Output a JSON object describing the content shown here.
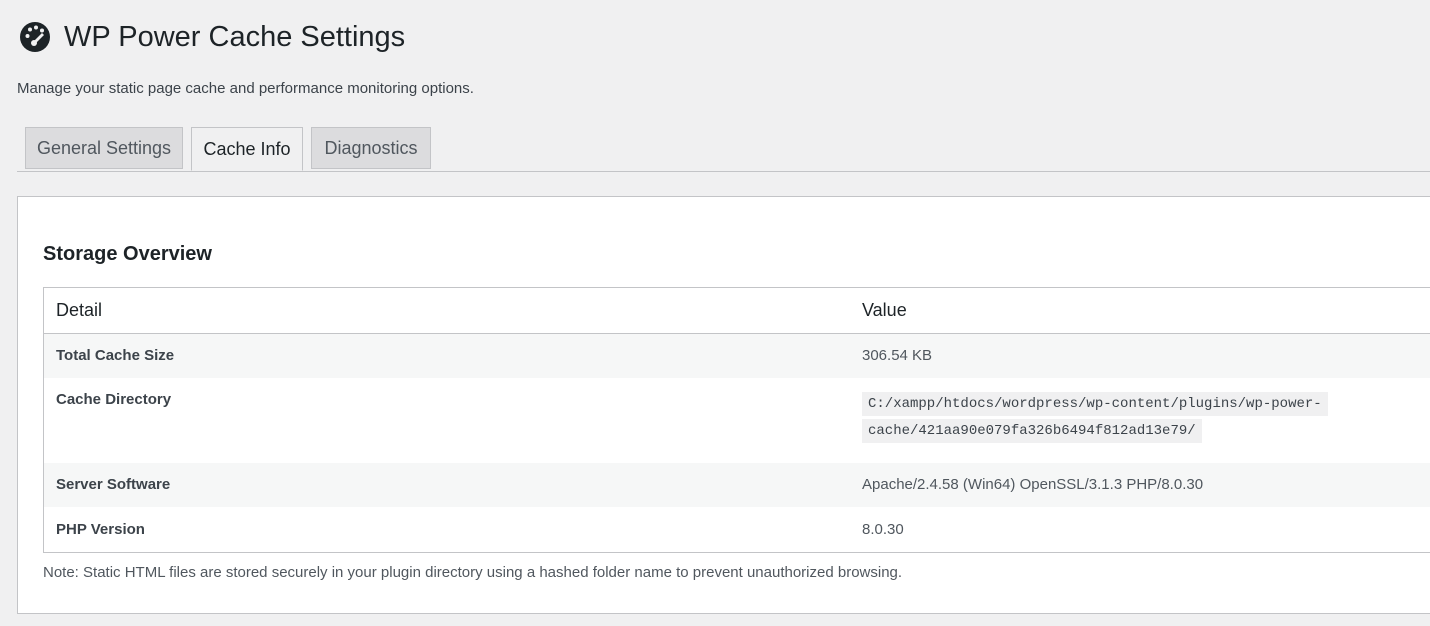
{
  "header": {
    "title": "WP Power Cache Settings",
    "description": "Manage your static page cache and performance monitoring options."
  },
  "tabs": [
    {
      "label": "General Settings",
      "active": false
    },
    {
      "label": "Cache Info",
      "active": true
    },
    {
      "label": "Diagnostics",
      "active": false
    }
  ],
  "panel": {
    "section_title": "Storage Overview",
    "columns": [
      "Detail",
      "Value"
    ],
    "rows": [
      {
        "label": "Total Cache Size",
        "value": "306.54 KB"
      },
      {
        "label": "Cache Directory",
        "value": "C:/xampp/htdocs/wordpress/wp-content/plugins/wp-power-cache/421aa90e079fa326b6494f812ad13e79/"
      },
      {
        "label": "Server Software",
        "value": "Apache/2.4.58 (Win64) OpenSSL/3.1.3 PHP/8.0.30"
      },
      {
        "label": "PHP Version",
        "value": "8.0.30"
      }
    ],
    "note": "Note: Static HTML files are stored securely in your plugin directory using a hashed folder name to prevent unauthorized browsing."
  },
  "icons": {
    "title_icon": "dashboard-gauge-icon"
  },
  "colors": {
    "background": "#f0f0f1",
    "panel": "#ffffff",
    "border": "#c3c4c7",
    "text": "#1d2327",
    "muted": "#50575e"
  }
}
